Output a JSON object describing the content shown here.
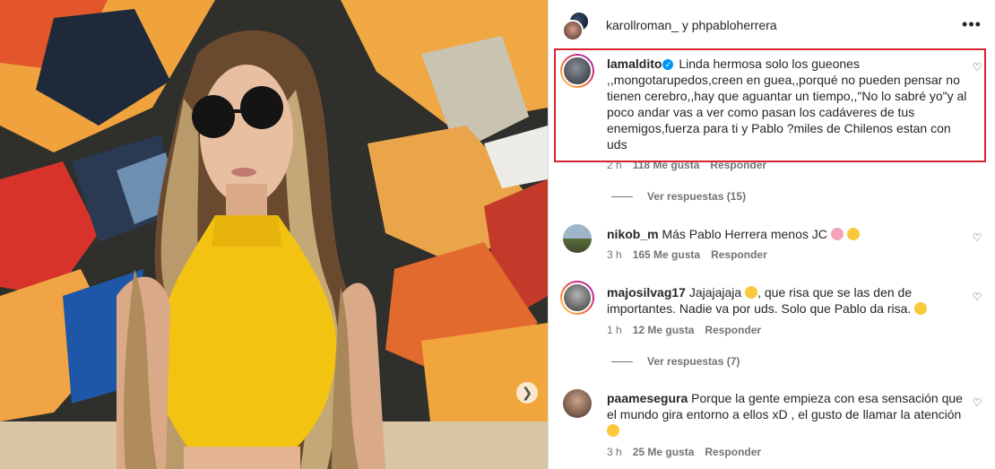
{
  "post": {
    "authors": "karollroman_ y phpabloherrera",
    "more_icon": "more-icon"
  },
  "comments": [
    {
      "username": "lamaldito",
      "verified": true,
      "text": "Linda hermosa solo los gueones ,,mongotarupedos,creen en guea,,porqué no pueden pensar no tienen cerebro,,hay que aguantar un tiempo,,\"No lo sabré yo\"y al poco andar vas a ver como pasan los cadáveres de tus enemigos,fuerza para ti y Pablo ?miles de Chilenos estan con uds",
      "time": "2 h",
      "likes": "118 Me gusta",
      "reply": "Responder",
      "view_replies": "Ver respuestas (15)"
    },
    {
      "username": "nikob_m",
      "text": "Más Pablo Herrera menos JC",
      "emojis": [
        "pig-face",
        "laughing"
      ],
      "time": "3 h",
      "likes": "165 Me gusta",
      "reply": "Responder"
    },
    {
      "username": "majosilvag17",
      "text_a": "Jajajajaja",
      "text_b": ", que risa que se las den de importantes. Nadie va por uds. Solo que Pablo da risa.",
      "emojis": [
        "rolling-laughing",
        "laughing"
      ],
      "time": "1 h",
      "likes": "12 Me gusta",
      "reply": "Responder",
      "view_replies": "Ver respuestas (7)"
    },
    {
      "username": "paamesegura",
      "text": "Porque la gente empieza con esa sensación que el mundo gira entorno a ellos xD , el gusto de llamar la atención",
      "emojis": [
        "laughing"
      ],
      "time": "3 h",
      "likes": "25 Me gusta",
      "reply": "Responder"
    }
  ],
  "colors": {
    "highlight": "#d9232e",
    "verified": "#0095f6",
    "meta_text": "#737373",
    "photo_top": "#f2a444"
  }
}
